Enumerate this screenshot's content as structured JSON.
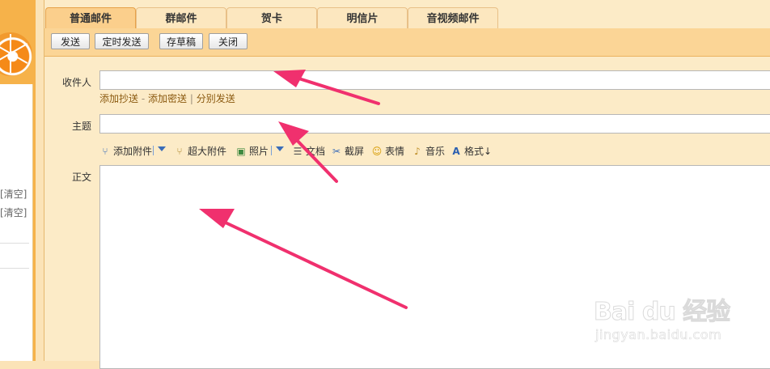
{
  "tabs": [
    {
      "label": "普通邮件",
      "active": true
    },
    {
      "label": "群邮件"
    },
    {
      "label": "贺卡"
    },
    {
      "label": "明信片"
    },
    {
      "label": "音视频邮件"
    }
  ],
  "toolbar": {
    "send": "发送",
    "scheduled_send": "定时发送",
    "save_draft": "存草稿",
    "close": "关闭"
  },
  "compose": {
    "recipient_label": "收件人",
    "recipient_value": "",
    "add_cc": "添加抄送",
    "dash": "-",
    "add_bcc": "添加密送",
    "pipe": "|",
    "separate_send": "分别发送",
    "subject_label": "主题",
    "subject_value": "",
    "body_label": "正文",
    "body_value": ""
  },
  "attach_bar": {
    "add_attachment": "添加附件",
    "large_attachment": "超大附件",
    "photo": "照片",
    "document": "文档",
    "screenshot": "截屏",
    "emoji": "表情",
    "music": "音乐",
    "format": "格式↓"
  },
  "sidebar": {
    "clear_1": "[清空]",
    "clear_2": "[清空]"
  },
  "colors": {
    "arrow": "#f0306e",
    "tab_active": "#fbcf8c",
    "toolbar": "#fbd596",
    "panel": "#fcebc7"
  },
  "watermark": {
    "logo": "Bai du 经验",
    "url": "jingyan.baidu.com"
  }
}
